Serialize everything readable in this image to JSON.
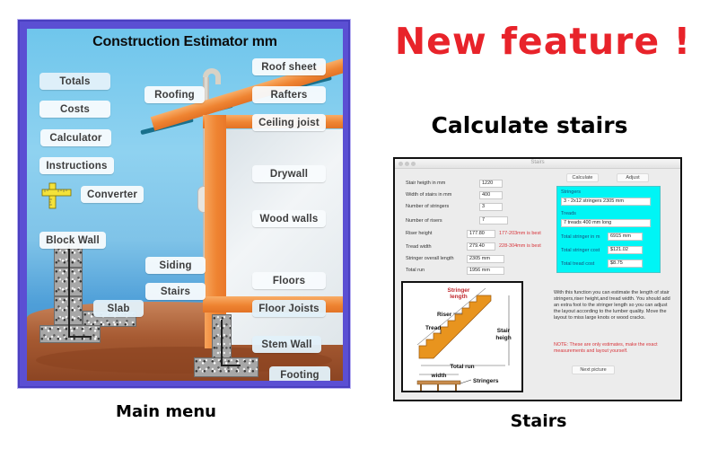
{
  "headline": "New feature !",
  "subheadline": "Calculate stairs",
  "captions": {
    "main": "Main menu",
    "stairs": "Stairs"
  },
  "main_menu": {
    "title": "Construction Estimator mm",
    "left_buttons": [
      {
        "label": "Totals"
      },
      {
        "label": "Costs"
      },
      {
        "label": "Calculator"
      },
      {
        "label": "Instructions"
      },
      {
        "label": "Converter"
      },
      {
        "label": "Block Wall"
      },
      {
        "label": "Slab"
      }
    ],
    "middle_buttons": [
      {
        "label": "Roofing"
      },
      {
        "label": "Siding"
      },
      {
        "label": "Stairs"
      }
    ],
    "right_buttons": [
      {
        "label": "Roof sheet"
      },
      {
        "label": "Rafters"
      },
      {
        "label": "Ceiling joist"
      },
      {
        "label": "Drywall"
      },
      {
        "label": "Wood walls"
      },
      {
        "label": "Floors"
      },
      {
        "label": "Floor Joists"
      },
      {
        "label": "Stem Wall"
      },
      {
        "label": "Footing"
      }
    ],
    "icons": {
      "converter": "ruler-icon"
    }
  },
  "stairs_window": {
    "title": "Stairs",
    "inputs": [
      {
        "label": "Stair heigth in mm",
        "value": "1220"
      },
      {
        "label": "Width of stairs in mm",
        "value": "400"
      },
      {
        "label": "Number of stringers",
        "value": "3"
      },
      {
        "label": "Number of risers",
        "value": "7"
      },
      {
        "label": "Riser height",
        "value": "177.80",
        "hint": "177-203mm is best"
      },
      {
        "label": "Tread width",
        "value": "279.40",
        "hint": "228-304mm is best"
      },
      {
        "label": "Stringer overall length",
        "value": "2305 mm"
      },
      {
        "label": "Total run",
        "value": "1956 mm"
      }
    ],
    "buttons": {
      "calculate": "Calculate",
      "adjust": "Adjust",
      "next_picture": "Next picture"
    },
    "results": {
      "stringers_label": "Stringers",
      "stringers_value": "3 - 2x12  stringers    2305 mm",
      "treads_label": "Treads",
      "treads_value": "7 treads    400    mm long",
      "total_stringer_label": "Total stringer in m",
      "total_stringer_value": "6915 mm",
      "total_stringer_cost_label": "Total stringer cost",
      "total_stringer_cost_value": "$121.02",
      "total_tread_cost_label": "Total tread cost",
      "total_tread_cost_value": "$8.75"
    },
    "diagram": {
      "stringer_length": [
        "Stringer",
        "length"
      ],
      "riser": "Riser",
      "tread": "Tread",
      "stair_height": [
        "Stair",
        "heigh"
      ],
      "total_run": "Total run",
      "width": "width",
      "stringers": "Stringers"
    },
    "description": "With this function you can estimate the length of stair stringers,riser height,and tread width. You should add an extra foot to the stringer length so you can adjust the layout according to the lumber quality. Move the layout to miss large knots or wood cracks.",
    "note": "NOTE: These are only estimates, make the exact measurements and layout yourself."
  },
  "colors": {
    "headline": "#e8232a",
    "frame": "#5b4fd3",
    "results_box": "#00f5f5",
    "hint_text": "#d8343a",
    "stair_wood": "#e8941e"
  }
}
